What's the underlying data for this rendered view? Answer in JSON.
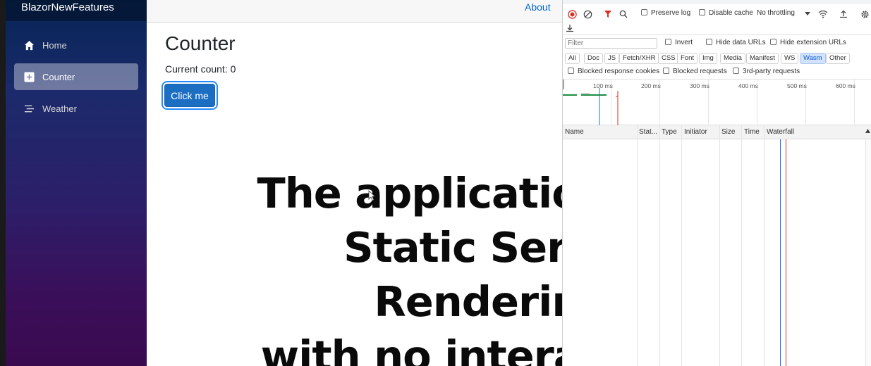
{
  "app": {
    "brand": "BlazorNewFeatures"
  },
  "nav": [
    {
      "label": "Home",
      "icon": "home-icon"
    },
    {
      "label": "Counter",
      "icon": "plus-square-icon",
      "active": true
    },
    {
      "label": "Weather",
      "icon": "list-icon"
    }
  ],
  "top_row": {
    "about": "About"
  },
  "page": {
    "title": "Counter",
    "count_text": "Current count: 0",
    "button_label": "Click me"
  },
  "caption": {
    "lines": [
      "The application uses",
      "Static Server Rendering",
      "with no interactivity"
    ]
  },
  "devtools": {
    "preserve_log": "Preserve log",
    "disable_cache": "Disable cache",
    "throttling": "No throttling",
    "filter_placeholder": "Filter",
    "invert": "Invert",
    "hide_data_urls": "Hide data URLs",
    "hide_extension_urls": "Hide extension URLs",
    "type_filters": [
      "All",
      "Doc",
      "JS",
      "Fetch/XHR",
      "CSS",
      "Font",
      "Img",
      "Media",
      "Manifest",
      "WS",
      "Wasm",
      "Other"
    ],
    "selected_filter": "Wasm",
    "blocked_response_cookies": "Blocked response cookies",
    "blocked_requests": "Blocked requests",
    "third_party_requests": "3rd-party requests",
    "timeline_labels": [
      "100 ms",
      "200 ms",
      "300 ms",
      "400 ms",
      "500 ms",
      "600 ms"
    ],
    "columns": [
      "Name",
      "Stat...",
      "Type",
      "Initiator",
      "Size",
      "Time",
      "Waterfall"
    ]
  },
  "colors": {
    "button": "#1b6ec2",
    "link": "#0366d6",
    "record": "#d93025",
    "filter_active": "#d93025"
  }
}
